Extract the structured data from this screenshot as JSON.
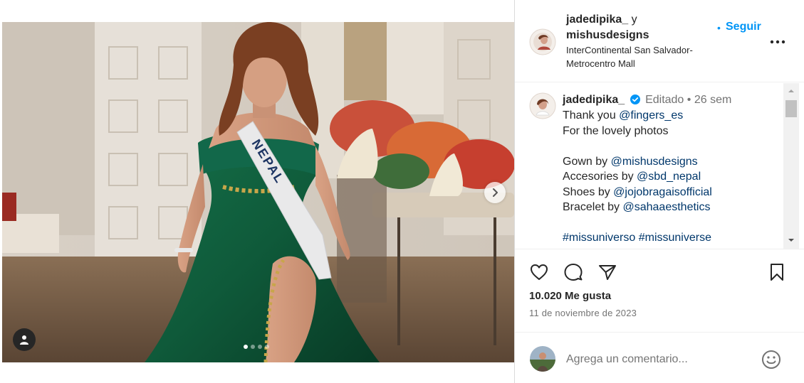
{
  "post": {
    "author1": "jadedipika_",
    "joiner": "y",
    "author2": "mishusdesigns",
    "location": "InterContinental San Salvador-Metrocentro Mall",
    "follow_label": "Seguir",
    "bullet": "•"
  },
  "caption": {
    "username": "jadedipika_",
    "meta": "Editado • 26 sem",
    "lines": [
      [
        {
          "t": "Thank you "
        },
        {
          "m": "@fingers_es"
        }
      ],
      [
        {
          "t": "For the lovely photos"
        }
      ],
      [],
      [
        {
          "t": "Gown by "
        },
        {
          "m": "@mishusdesigns"
        }
      ],
      [
        {
          "t": "Accesories by "
        },
        {
          "m": "@sbd_nepal"
        }
      ],
      [
        {
          "t": "Shoes by "
        },
        {
          "m": "@jojobragaisofficial"
        }
      ],
      [
        {
          "t": "Bracelet by "
        },
        {
          "m": "@sahaaesthetics"
        }
      ],
      [],
      [
        {
          "m": "#missuniverso"
        },
        {
          "t": " "
        },
        {
          "m": "#missuniverse"
        }
      ]
    ]
  },
  "media": {
    "sash_text": "NEPAL",
    "carousel_count": 4,
    "carousel_active": 1
  },
  "stats": {
    "likes": "10.020 Me gusta",
    "date": "11 de noviembre de 2023"
  },
  "comment": {
    "placeholder": "Agrega un comentario..."
  },
  "colors": {
    "link": "#0095f6",
    "mention": "#00376b",
    "verified": "#0095f6",
    "gown": "#0f5a3a"
  },
  "icons": {
    "like": "heart-icon",
    "comment": "comment-icon",
    "share": "paper-plane-icon",
    "save": "bookmark-icon",
    "more": "more-options-icon",
    "emoji": "emoji-icon",
    "tags": "user-tag-icon",
    "next": "chevron-right-icon"
  }
}
